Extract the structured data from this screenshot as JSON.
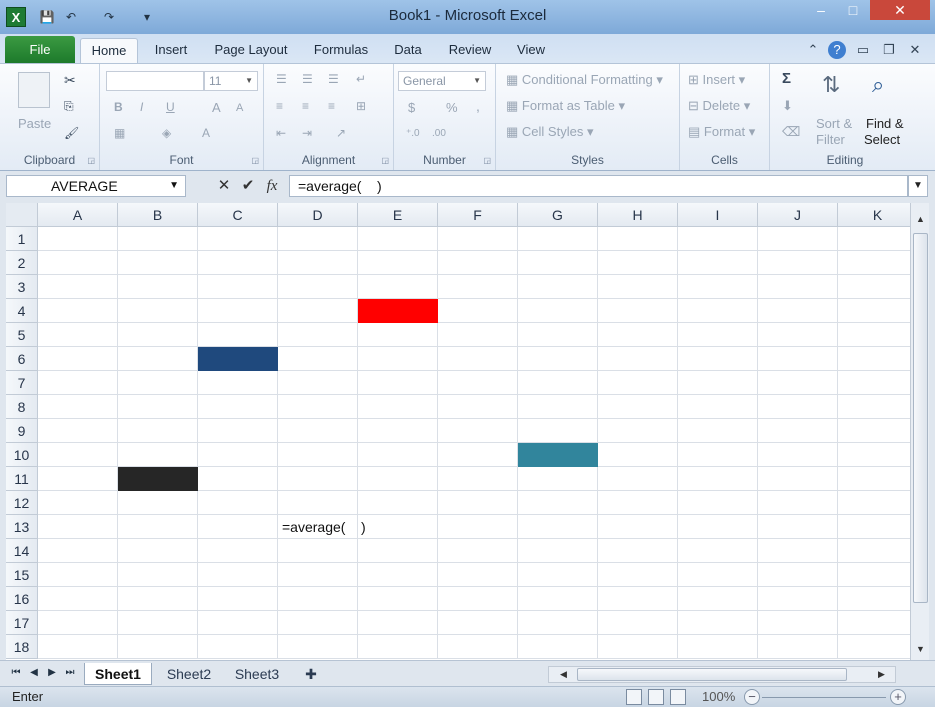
{
  "window": {
    "title": "Book1  -  Microsoft Excel",
    "logo": "X",
    "controls": [
      "–",
      "□",
      "✕"
    ]
  },
  "qat": {
    "save_icon": "💾",
    "undo_icon": "↶",
    "redo_icon": "↷",
    "customize_icon": "▾"
  },
  "ribbon": {
    "file_tab": "File",
    "tabs": [
      "Home",
      "Insert",
      "Page Layout",
      "Formulas",
      "Data",
      "Review",
      "View"
    ],
    "active_tab": "Home",
    "groups": {
      "clipboard": {
        "label": "Clipboard",
        "paste": "Paste"
      },
      "font": {
        "label": "Font",
        "font_name": "",
        "font_size": "11",
        "bold": "B",
        "italic": "I",
        "underline": "U",
        "grow": "A",
        "shrink": "A",
        "color": "A"
      },
      "alignment": {
        "label": "Alignment"
      },
      "number": {
        "label": "Number",
        "format": "General",
        "currency": "$",
        "percent": "%",
        "comma": ","
      },
      "styles": {
        "label": "Styles",
        "conditional": "Conditional Formatting",
        "table": "Format as Table",
        "cell_styles": "Cell Styles"
      },
      "cells": {
        "label": "Cells",
        "insert": "Insert",
        "delete": "Delete",
        "format": "Format"
      },
      "editing": {
        "label": "Editing",
        "sum": "Σ",
        "sort": "Sort &",
        "filter": "Filter",
        "find": "Find &",
        "select": "Select"
      }
    }
  },
  "formula_bar": {
    "name_box": "AVERAGE",
    "cancel_icon": "✕",
    "enter_icon": "✔",
    "fx_label": "fx",
    "formula": "=average(    )"
  },
  "grid": {
    "columns": [
      "A",
      "B",
      "C",
      "D",
      "E",
      "F",
      "G",
      "H",
      "I",
      "J",
      "K"
    ],
    "rows": [
      "1",
      "2",
      "3",
      "4",
      "5",
      "6",
      "7",
      "8",
      "9",
      "10",
      "11",
      "12",
      "13",
      "14",
      "15",
      "16",
      "17",
      "18"
    ],
    "cell_text": {
      "D13": "=average(    )"
    },
    "filled_cells": [
      {
        "cell": "E4",
        "color": "#ff0000"
      },
      {
        "cell": "C6",
        "color": "#1f497d"
      },
      {
        "cell": "G10",
        "color": "#31859c"
      },
      {
        "cell": "B11",
        "color": "#262626"
      }
    ]
  },
  "sheets": {
    "tabs": [
      "Sheet1",
      "Sheet2",
      "Sheet3"
    ],
    "active": "Sheet1"
  },
  "status": {
    "mode": "Enter",
    "zoom": "100%"
  }
}
